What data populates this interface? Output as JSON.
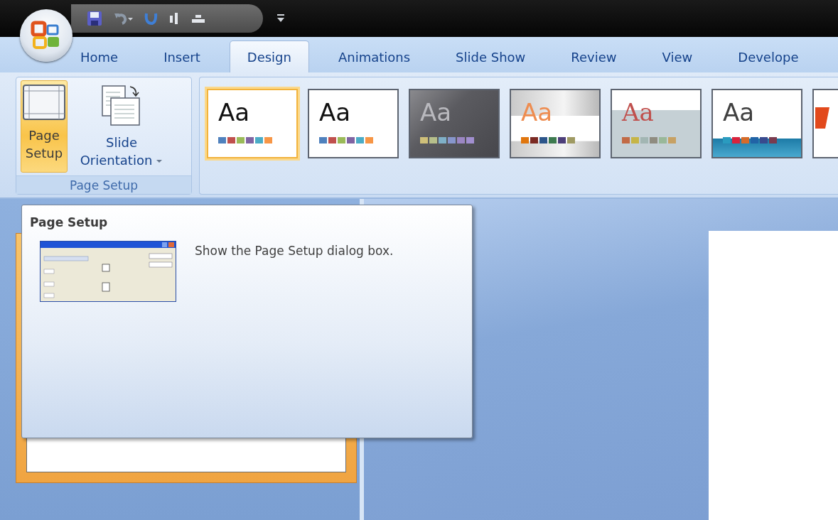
{
  "tabs": [
    {
      "label": "Home",
      "selected": false
    },
    {
      "label": "Insert",
      "selected": false
    },
    {
      "label": "Design",
      "selected": true
    },
    {
      "label": "Animations",
      "selected": false
    },
    {
      "label": "Slide Show",
      "selected": false
    },
    {
      "label": "Review",
      "selected": false
    },
    {
      "label": "View",
      "selected": false
    },
    {
      "label": "Develope",
      "selected": false
    }
  ],
  "ribbon": {
    "group": {
      "title": "Page Setup",
      "buttons": [
        {
          "label": "Page Setup",
          "kind": "page",
          "selected": true
        },
        {
          "label": "Slide Orientation",
          "kind": "orientation",
          "selected": false
        }
      ]
    },
    "themes": [
      {
        "label": "Aa",
        "kind": "office",
        "selected": true
      },
      {
        "label": "Aa",
        "kind": "plain",
        "selected": false
      },
      {
        "label": "Aa",
        "kind": "dark",
        "selected": false
      },
      {
        "label": "Aa",
        "kind": "gradient",
        "selected": false
      },
      {
        "label": "Aa",
        "kind": "serif",
        "selected": false
      },
      {
        "label": "Aa",
        "kind": "wave",
        "selected": false
      },
      {
        "kind": "edge",
        "selected": false
      }
    ]
  },
  "tooltip": {
    "title": "Page Setup",
    "description": "Show the Page Setup dialog box."
  },
  "slides_pane": {
    "thumbnail": {
      "selected": true
    }
  }
}
